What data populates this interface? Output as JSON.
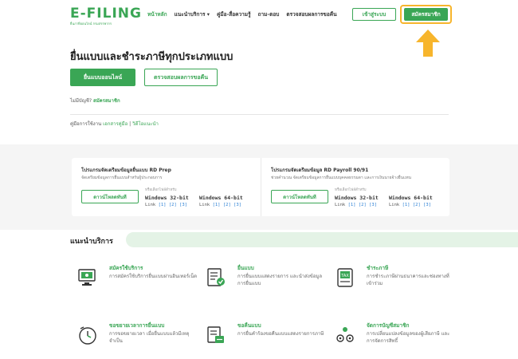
{
  "header": {
    "logo_text": "E-FILING",
    "logo_sub": "ยื่นภาษีออนไลน์ กรมสรรพากร",
    "nav": [
      {
        "label": "หน้าหลัก",
        "active": true
      },
      {
        "label": "แนะนำบริการ ▾",
        "active": false
      },
      {
        "label": "คู่มือ-สื่อความรู้",
        "active": false
      },
      {
        "label": "ถาม-ตอบ",
        "active": false
      },
      {
        "label": "ตรวจสอบผลการขอคืน",
        "active": false
      }
    ],
    "login_label": "เข้าสู่ระบบ",
    "register_label": "สมัครสมาชิก"
  },
  "hero": {
    "title": "ยื่นแบบและชำระภาษีทุกประเภทแบบ",
    "file_online_label": "ยื่นแบบออนไลน์",
    "check_refund_label": "ตรวจสอบผลการขอคืน",
    "no_account_text": "ไม่มีบัญชี?",
    "no_account_link": "สมัครสมาชิก",
    "manual_label": "คู่มือการใช้งาน",
    "manual_link1": "เอกสารคู่มือ",
    "manual_sep": "|",
    "manual_link2": "วิดีโอแนะนำ"
  },
  "programs": [
    {
      "title": "โปรแกรมจัดเตรียมข้อมูลยื่นแบบ RD Prep",
      "desc": "จัดเตรียมข้อมูลการยื่นแบบสำหรับผู้ประกอบการ",
      "download_label": "ดาวน์โหลดทันที",
      "or_select": "หรือเลือกไฟล์สำหรับ",
      "os": [
        {
          "name": "Windows 32-bit",
          "links_prefix": "Link",
          "links": [
            "[1]",
            "[2]",
            "[3]"
          ]
        },
        {
          "name": "Windows 64-bit",
          "links_prefix": "Link",
          "links": [
            "[1]",
            "[2]",
            "[3]"
          ]
        }
      ]
    },
    {
      "title": "โปรแกรมจัดเตรียมข้อมูล RD Payroll 90/91",
      "desc": "ช่วยคำนวณ จัดเตรียมข้อมูลการยื่นแบบบุคคลธรรมดา และการเงินนายจ้างยื่นแทน",
      "download_label": "ดาวน์โหลดทันที",
      "or_select": "หรือเลือกไฟล์สำหรับ",
      "os": [
        {
          "name": "Windows 32-bit",
          "links_prefix": "Link",
          "links": [
            "[1]",
            "[2]",
            "[3]"
          ]
        },
        {
          "name": "Windows 64-bit",
          "links_prefix": "Link",
          "links": [
            "[1]",
            "[2]",
            "[3]"
          ]
        }
      ]
    }
  ],
  "services": {
    "title": "แนะนำบริการ",
    "items": [
      {
        "icon": "register-computer-icon",
        "name": "สมัครใช้บริการ",
        "desc": "การสมัครใช้บริการยื่นแบบผ่านอินเทอร์เน็ต"
      },
      {
        "icon": "file-form-icon",
        "name": "ยื่นแบบ",
        "desc": "การยื่นแบบแสดงรายการ และนำส่งข้อมูลการยื่นแบบ"
      },
      {
        "icon": "tax-payment-icon",
        "name": "ชำระภาษี",
        "desc": "การชำระภาษีผ่านธนาคารและช่องทางที่เข้าร่วม"
      },
      {
        "icon": "clock-extension-icon",
        "name": "ขอขยายเวลาการยื่นแบบ",
        "desc": "การขอขยายเวลา เมื่อยื่นแบบแล้วมีเหตุจำเป็น"
      },
      {
        "icon": "refund-document-icon",
        "name": "ขอคืนแบบ",
        "desc": "การยื่นคำร้องขอคืนแบบแสดงรายการภาษี"
      },
      {
        "icon": "member-account-icon",
        "name": "จัดการบัญชีสมาชิก",
        "desc": "การเปลี่ยนแปลงข้อมูลของผู้เสียภาษี และการจัดการสิทธิ์"
      }
    ]
  },
  "colors": {
    "accent": "#3aa655",
    "highlight": "#f7b52c"
  }
}
